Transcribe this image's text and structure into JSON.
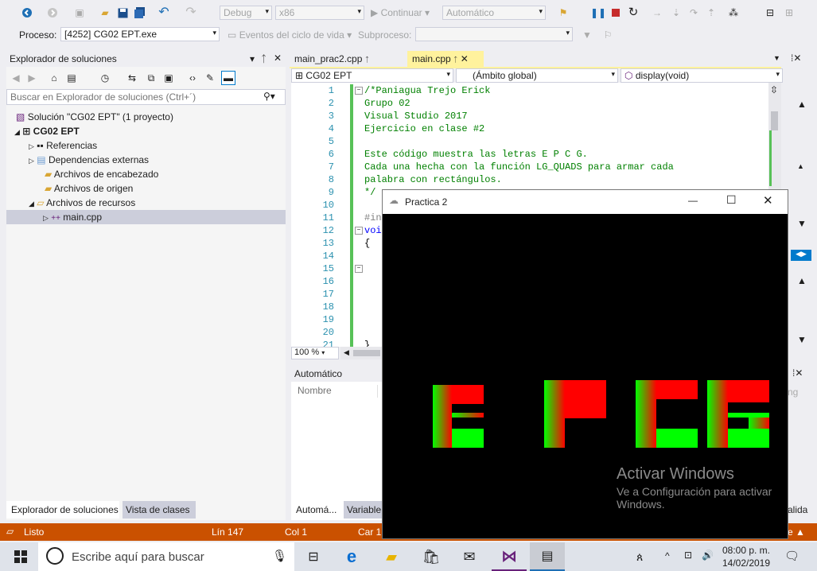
{
  "toolbar1": {
    "config": "Debug",
    "platform": "x86",
    "continue": "Continuar",
    "auto_combo": "Automático"
  },
  "toolbar2": {
    "process_label": "Proceso:",
    "process_value": "[4252] CG02 EPT.exe",
    "lifecycle": "Eventos del ciclo de vida",
    "thread_label": "Subproceso:"
  },
  "solution_explorer": {
    "title": "Explorador de soluciones",
    "search_placeholder": "Buscar en Explorador de soluciones (Ctrl+´)",
    "solution": "Solución \"CG02 EPT\" (1 proyecto)",
    "project": "CG02 EPT",
    "items": [
      {
        "label": "Referencias"
      },
      {
        "label": "Dependencias externas"
      },
      {
        "label": "Archivos de encabezado"
      },
      {
        "label": "Archivos de origen"
      },
      {
        "label": "Archivos de recursos"
      },
      {
        "label": "main.cpp"
      }
    ],
    "tab1": "Explorador de soluciones",
    "tab2": "Vista de clases"
  },
  "editor": {
    "tab_inactive": "main_prac2.cpp",
    "tab_active": "main.cpp",
    "nav_project": "CG02 EPT",
    "nav_scope": "(Ámbito global)",
    "nav_member": "display(void)",
    "zoom": "100 %",
    "line_numbers": [
      "1",
      "2",
      "3",
      "4",
      "5",
      "6",
      "7",
      "8",
      "9",
      "10",
      "11",
      "12",
      "13",
      "14",
      "15",
      "16",
      "17",
      "18",
      "19",
      "20",
      "21"
    ],
    "lines": [
      "/*Paniagua Trejo Erick",
      "Grupo 02",
      "Visual Studio 2017",
      "Ejercicio en clase #2",
      "",
      "Este código muestra las letras E P C G.",
      "Cada una hecha con la función LG_QUADS para armar cada",
      "palabra con rectángulos.",
      "*/",
      "",
      "#in",
      "voi",
      "{",
      "",
      "",
      "",
      "",
      "",
      "",
      "",
      "}"
    ]
  },
  "autos": {
    "title": "Automático",
    "col_name": "Nombre",
    "tab1": "Automá...",
    "tab2": "Variable"
  },
  "right_partial": {
    "ng": "ng",
    "validation": "alida"
  },
  "status": {
    "ready": "Listo",
    "line": "Lín 147",
    "col": "Col 1",
    "car": "Car 1"
  },
  "gl_window": {
    "title": "Practica 2",
    "watermark_title": "Activar Windows",
    "watermark_sub1": "Ve a Configuración para activar",
    "watermark_sub2": "Windows."
  },
  "taskbar": {
    "search_placeholder": "Escribe aquí para buscar",
    "time": "08:00 p. m.",
    "date": "14/02/2019"
  },
  "colors": {
    "vs_blue": "#007acc",
    "status_orange": "#ca5100",
    "tab_active_yellow": "#fff29d",
    "gl_red": "#ff0000",
    "gl_green": "#00ff00"
  }
}
